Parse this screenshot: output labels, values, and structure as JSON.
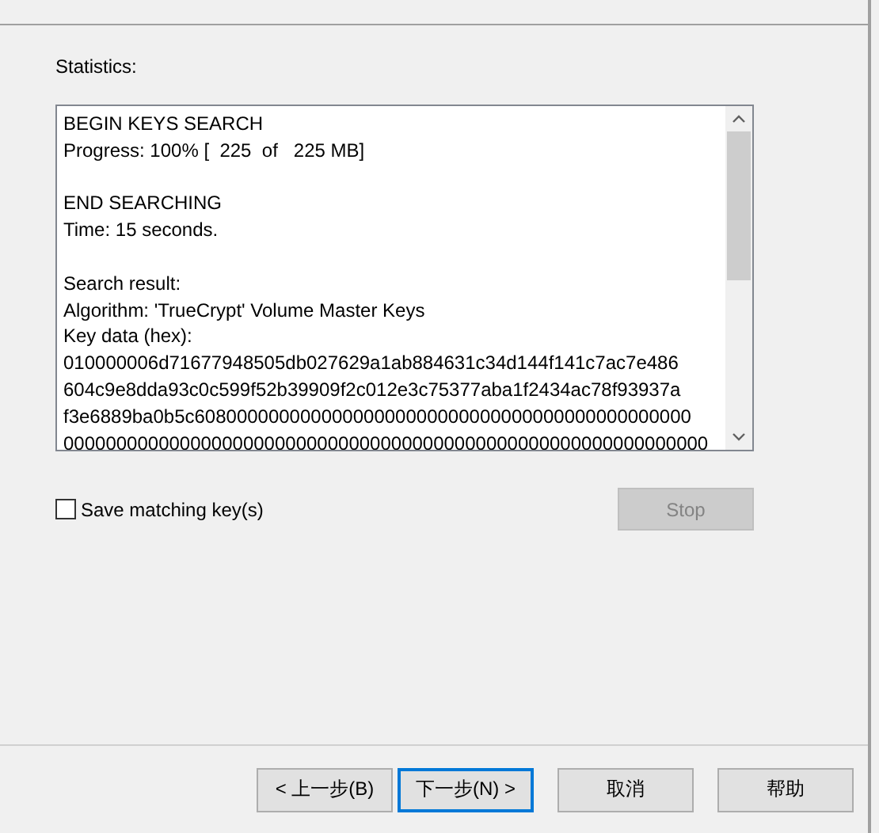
{
  "statistics_label": "Statistics:",
  "log": {
    "blocks": [
      [
        "BEGIN KEYS SEARCH",
        "Progress: 100% [  225  of   225 MB]"
      ],
      [
        "END SEARCHING",
        "Time: 15 seconds."
      ],
      [
        "Search result:",
        "Algorithm: 'TrueCrypt' Volume Master Keys",
        "Key data (hex):",
        "010000006d71677948505db027629a1ab884631c34d144f141c7ac7e486",
        "604c9e8dda93c0c599f52b39909f2c012e3c75377aba1f2434ac78f93937a",
        "f3e6889ba0b5c60800000000000000000000000000000000000000000000",
        "0000000000000000000000000000000000000000000000000000000000000"
      ]
    ]
  },
  "save_checkbox": {
    "label": "Save matching key(s)",
    "checked": false
  },
  "stop_button": {
    "label": "Stop",
    "disabled": true
  },
  "buttons": [
    {
      "label": "< 上一步(B)",
      "focused": false
    },
    {
      "label": "下一步(N) >",
      "focused": true
    },
    {
      "label": "取消",
      "focused": false
    },
    {
      "label": "帮助",
      "focused": false
    }
  ]
}
